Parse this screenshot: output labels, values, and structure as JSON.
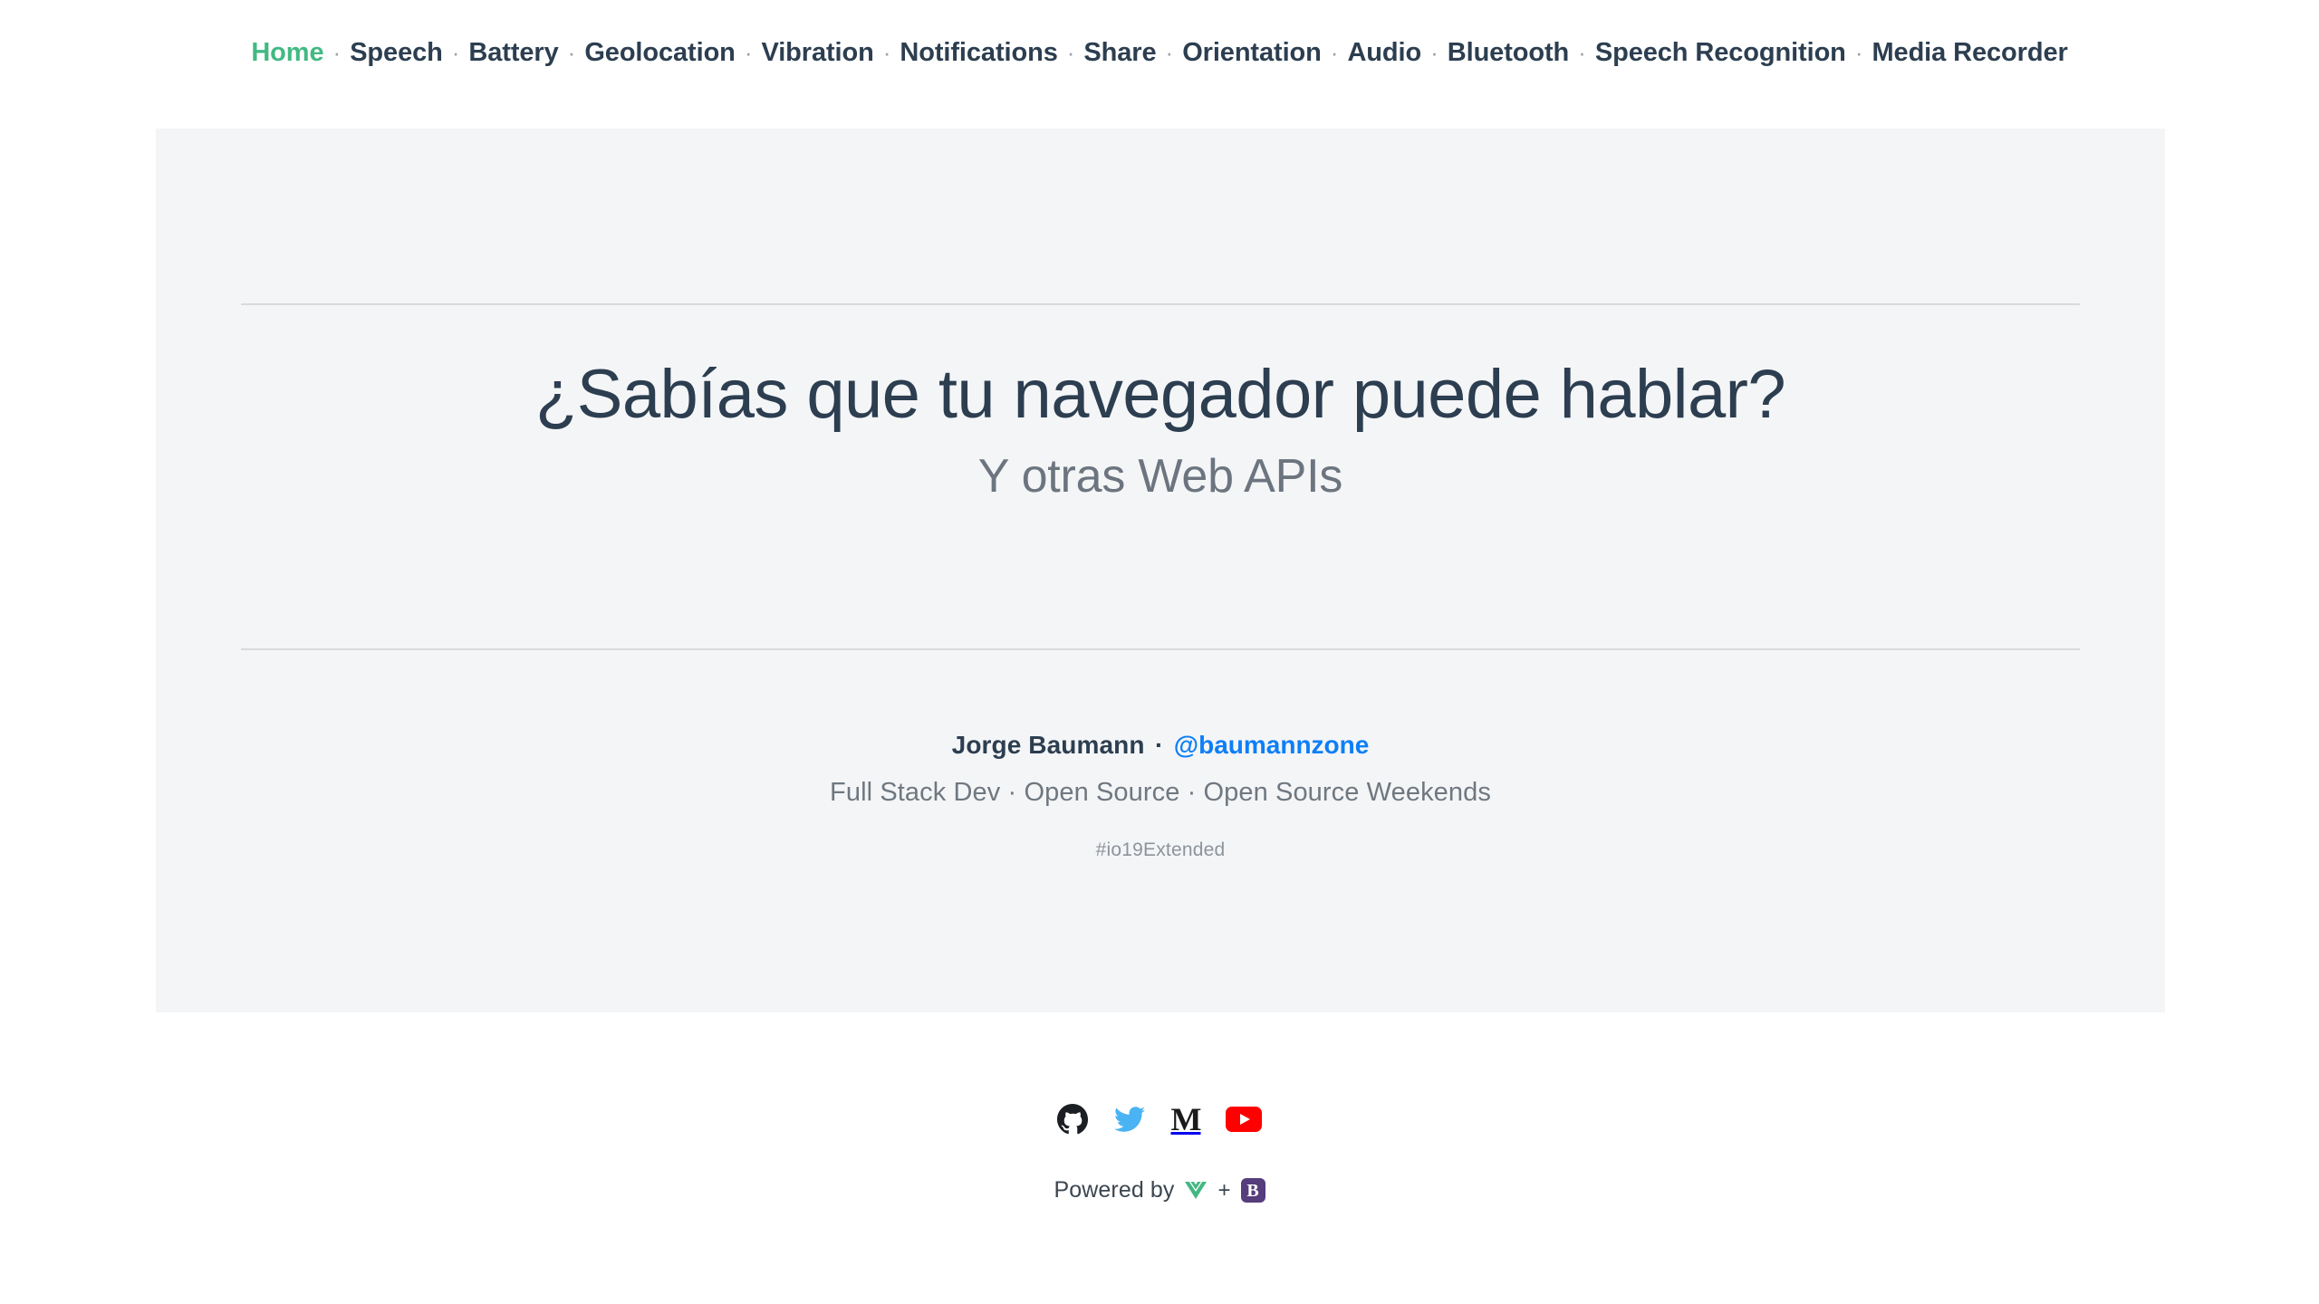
{
  "nav": {
    "separator": "·",
    "items": [
      {
        "label": "Home",
        "active": true
      },
      {
        "label": "Speech",
        "active": false
      },
      {
        "label": "Battery",
        "active": false
      },
      {
        "label": "Geolocation",
        "active": false
      },
      {
        "label": "Vibration",
        "active": false
      },
      {
        "label": "Notifications",
        "active": false
      },
      {
        "label": "Share",
        "active": false
      },
      {
        "label": "Orientation",
        "active": false
      },
      {
        "label": "Audio",
        "active": false
      },
      {
        "label": "Bluetooth",
        "active": false
      },
      {
        "label": "Speech Recognition",
        "active": false
      },
      {
        "label": "Media Recorder",
        "active": false
      }
    ]
  },
  "slide": {
    "title": "¿Sabías que tu navegador puede hablar?",
    "subtitle": "Y otras Web APIs",
    "author_name": "Jorge Baumann",
    "author_separator": "·",
    "author_handle": "@baumannzone",
    "author_role": "Full Stack Dev · Open Source · Open Source Weekends",
    "hashtag": "#io19Extended"
  },
  "social": [
    {
      "name": "github",
      "label": "GitHub",
      "color": "#1b1f23"
    },
    {
      "name": "twitter",
      "label": "Twitter",
      "color": "#4ab3f4"
    },
    {
      "name": "medium",
      "label": "Medium",
      "glyph": "M",
      "color": "#1a1a1a"
    },
    {
      "name": "youtube",
      "label": "YouTube",
      "color": "#ff0000"
    }
  ],
  "footer": {
    "text": "Powered by",
    "plus": "+",
    "vue_label": "Vue.js",
    "vue_color": "#42b883",
    "bootstrap_label": "Bootstrap",
    "bootstrap_glyph": "B",
    "bootstrap_color": "#563d7c"
  },
  "theme": {
    "page_bg": "#ffffff",
    "panel_bg": "#f4f5f7",
    "text_dark": "#2c3e50",
    "text_muted": "#6f7880",
    "accent_green": "#42b983",
    "link_blue": "#0d7ff7",
    "rule": "#d8dadd"
  }
}
